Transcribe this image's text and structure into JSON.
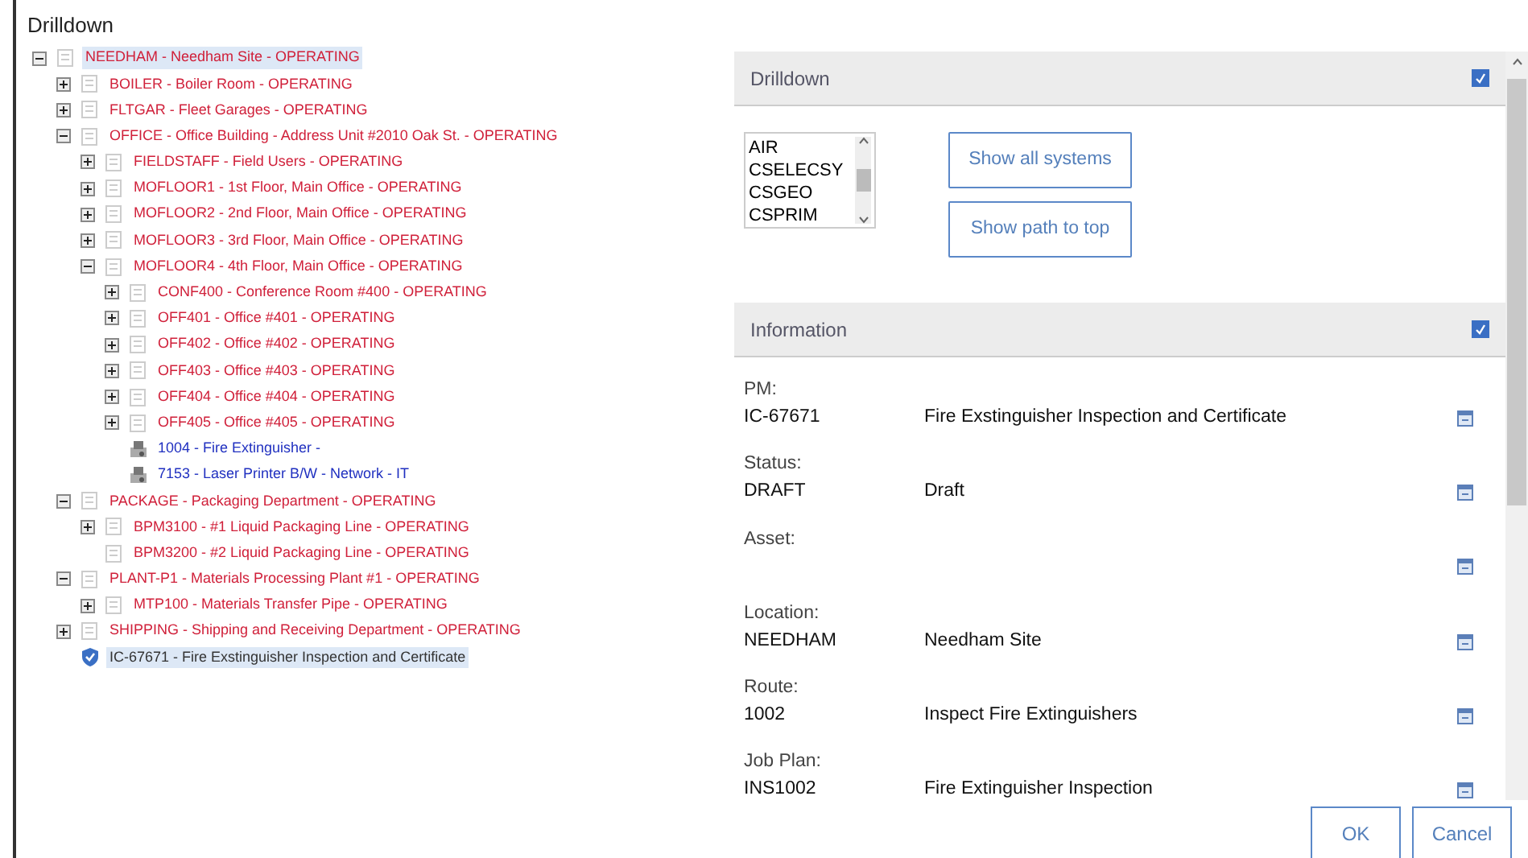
{
  "window": {
    "title": "Drilldown"
  },
  "tree": [
    {
      "label": "NEEDHAM - Needham Site - OPERATING",
      "kind": "location",
      "expanded": true,
      "selected": true,
      "children": [
        {
          "label": "BOILER - Boiler Room - OPERATING",
          "kind": "location",
          "expanded": false,
          "selected": false
        },
        {
          "label": "FLTGAR - Fleet Garages - OPERATING",
          "kind": "location",
          "expanded": false,
          "selected": false
        },
        {
          "label": "OFFICE - Office Building - Address Unit #2010 Oak St. - OPERATING",
          "kind": "location",
          "expanded": true,
          "selected": false,
          "children": [
            {
              "label": "FIELDSTAFF - Field Users - OPERATING",
              "kind": "location",
              "expanded": false,
              "selected": false
            },
            {
              "label": "MOFLOOR1 - 1st Floor, Main Office - OPERATING",
              "kind": "location",
              "expanded": false,
              "selected": false
            },
            {
              "label": "MOFLOOR2 - 2nd Floor, Main Office - OPERATING",
              "kind": "location",
              "expanded": false,
              "selected": false
            },
            {
              "label": "MOFLOOR3 - 3rd Floor, Main Office - OPERATING",
              "kind": "location",
              "expanded": false,
              "selected": false
            },
            {
              "label": "MOFLOOR4 - 4th Floor, Main Office - OPERATING",
              "kind": "location",
              "expanded": true,
              "selected": false,
              "children": [
                {
                  "label": "CONF400 - Conference Room #400 - OPERATING",
                  "kind": "location",
                  "expanded": false,
                  "selected": false
                },
                {
                  "label": "OFF401 - Office #401 - OPERATING",
                  "kind": "location",
                  "expanded": false,
                  "selected": false
                },
                {
                  "label": "OFF402 - Office #402 - OPERATING",
                  "kind": "location",
                  "expanded": false,
                  "selected": false
                },
                {
                  "label": "OFF403 - Office #403 - OPERATING",
                  "kind": "location",
                  "expanded": false,
                  "selected": false
                },
                {
                  "label": "OFF404 - Office #404 - OPERATING",
                  "kind": "location",
                  "expanded": false,
                  "selected": false
                },
                {
                  "label": "OFF405 - Office #405 - OPERATING",
                  "kind": "location",
                  "expanded": false,
                  "selected": false
                },
                {
                  "label": "1004 - Fire Extinguisher -",
                  "kind": "asset",
                  "selected": false
                },
                {
                  "label": "7153 - Laser Printer B/W - Network - IT",
                  "kind": "asset",
                  "selected": false
                }
              ]
            }
          ]
        },
        {
          "label": "PACKAGE - Packaging Department - OPERATING",
          "kind": "location",
          "expanded": true,
          "selected": false,
          "children": [
            {
              "label": "BPM3100 - #1 Liquid Packaging Line - OPERATING",
              "kind": "location",
              "expanded": false,
              "selected": false
            },
            {
              "label": "BPM3200 - #2 Liquid Packaging Line - OPERATING",
              "kind": "location",
              "selected": false
            }
          ]
        },
        {
          "label": "PLANT-P1 - Materials Processing Plant #1 - OPERATING",
          "kind": "location",
          "expanded": true,
          "selected": false,
          "children": [
            {
              "label": "MTP100 - Materials Transfer Pipe - OPERATING",
              "kind": "location",
              "expanded": false,
              "selected": false
            }
          ]
        },
        {
          "label": "SHIPPING - Shipping and Receiving Department - OPERATING",
          "kind": "location",
          "expanded": false,
          "selected": false
        },
        {
          "label": "IC-67671 - Fire Exstinguisher Inspection and Certificate",
          "kind": "pm",
          "selected": true
        }
      ]
    }
  ],
  "drilldown_section": {
    "title": "Drilldown",
    "systems": [
      "AIR",
      "CSELECSY",
      "CSGEO",
      "CSPRIM"
    ],
    "buttons": [
      "Show all systems",
      "Show path to top"
    ]
  },
  "information_section": {
    "title": "Information",
    "fields": [
      {
        "label": "PM:",
        "value": "IC-67671",
        "description": "Fire Exstinguisher Inspection and Certificate"
      },
      {
        "label": "Status:",
        "value": "DRAFT",
        "description": "Draft"
      },
      {
        "label": "Asset:"
      },
      {
        "label": "Location:",
        "value": "NEEDHAM",
        "description": "Needham Site"
      },
      {
        "label": "Route:",
        "value": "1002",
        "description": "Inspect Fire Extinguishers"
      },
      {
        "label": "Job Plan:",
        "value": "INS1002",
        "description": "Fire Extinguisher Inspection"
      }
    ]
  },
  "footer_buttons": [
    "OK",
    "Cancel"
  ]
}
